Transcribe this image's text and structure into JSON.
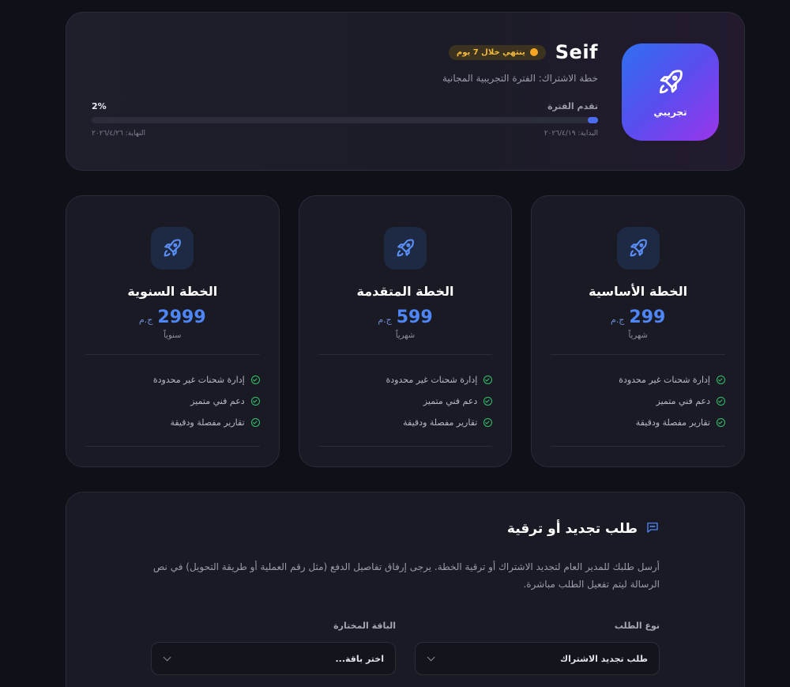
{
  "subscription": {
    "user_name": "Seif",
    "expiry_badge": "ينتهي خلال 7 يوم",
    "plan_line": "خطة الاشتراك: الفترة التجريبية المجانية",
    "icon_label": "تجريبي",
    "icon": "rocket-icon",
    "progress_label": "تقدم الفترة",
    "progress_pct_text": "2%",
    "progress_value": 0.02,
    "start_date": "البداية: ٢٠٢٦/٤/١٩",
    "end_date": "النهاية: ٢٠٢٦/٤/٢٦"
  },
  "plans": [
    {
      "title": "الخطة الأساسية",
      "price": "299",
      "currency": "ج.م",
      "period": "شهرياً",
      "features": [
        "إدارة شحنات غير محدودة",
        "دعم فني متميز",
        "تقارير مفصلة ودقيقة"
      ]
    },
    {
      "title": "الخطة المتقدمة",
      "price": "599",
      "currency": "ج.م",
      "period": "شهرياً",
      "features": [
        "إدارة شحنات غير محدودة",
        "دعم فني متميز",
        "تقارير مفصلة ودقيقة"
      ]
    },
    {
      "title": "الخطة السنوية",
      "price": "2999",
      "currency": "ج.م",
      "period": "سنوياً",
      "features": [
        "إدارة شحنات غير محدودة",
        "دعم فني متميز",
        "تقارير مفصلة ودقيقة"
      ]
    }
  ],
  "request": {
    "title": "طلب تجديد أو ترقية",
    "description": "أرسل طلبك للمدير العام لتجديد الاشتراك أو ترقية الخطة. يرجى إرفاق تفاصيل الدفع (مثل رقم العملية أو طريقة التحويل) في نص الرسالة ليتم تفعيل الطلب مباشرة.",
    "type_label": "نوع الطلب",
    "type_value": "طلب تجديد الاشتراك",
    "package_label": "الباقة المختارة",
    "package_placeholder": "اختر باقة..."
  },
  "colors": {
    "background": "#0f1018",
    "accent": "#4f86f7",
    "warning": "#f5b93a",
    "success": "#32c36c"
  }
}
